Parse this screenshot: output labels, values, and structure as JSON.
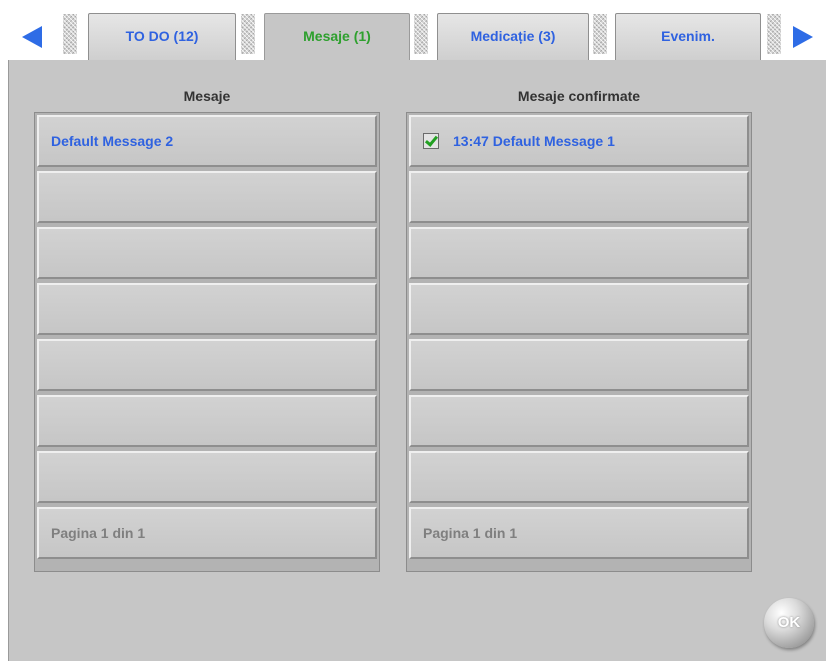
{
  "tabs": [
    {
      "label": "TO DO (12)",
      "active": false
    },
    {
      "label": "Mesaje (1)",
      "active": true
    },
    {
      "label": "Medicație (3)",
      "active": false
    },
    {
      "label": "Evenim.",
      "active": false
    }
  ],
  "nav": {
    "prev_icon": "arrow-left-icon",
    "next_icon": "arrow-right-icon"
  },
  "messages": {
    "title": "Mesaje",
    "items": [
      "Default Message 2",
      "",
      "",
      "",
      "",
      "",
      ""
    ],
    "footer": "Pagina 1 din 1"
  },
  "confirmed": {
    "title": "Mesaje confirmate",
    "items": [
      {
        "time": "13:47",
        "text": "Default Message 1",
        "checked": true
      }
    ],
    "footer": "Pagina 1 din 1"
  },
  "ok_label": "OK",
  "colors": {
    "accent": "#2f62e0",
    "active_tab": "#2ea02e",
    "panel": "#c6c6c6",
    "muted": "#7f7f7f"
  }
}
